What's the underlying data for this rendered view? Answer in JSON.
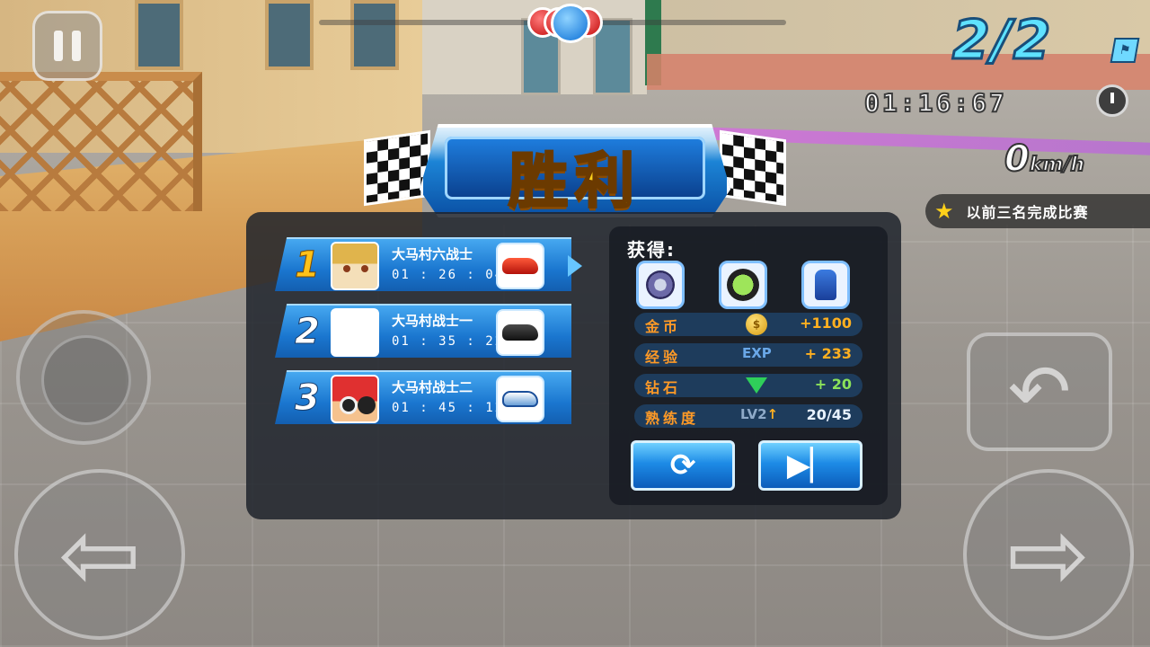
{
  "hud": {
    "lap": "2/2",
    "timer": "01:16:67",
    "speed_value": "0",
    "speed_unit": "km/h",
    "mission": "以前三名完成比赛"
  },
  "banner": {
    "title": "胜利"
  },
  "results": [
    {
      "rank": "1",
      "name": "大马村六战士",
      "time": "01 : 26 : 04",
      "car": "red-sportscar"
    },
    {
      "rank": "2",
      "name": "大马村战士一",
      "time": "01 : 35 : 22",
      "car": "black-sportscar"
    },
    {
      "rank": "3",
      "name": "大马村战士二",
      "time": "01 : 45 : 12",
      "car": "white-racecar"
    }
  ],
  "rewards": {
    "title": "获得:",
    "items": [
      "steering-wheel-icon",
      "tire-icon",
      "seat-icon"
    ],
    "stats": [
      {
        "label": "金币",
        "icon": "coin-icon",
        "value": "+1100"
      },
      {
        "label": "经验",
        "icon_text": "EXP",
        "value": "+ 233"
      },
      {
        "label": "钻石",
        "icon": "diamond-icon",
        "value": "+ 20"
      },
      {
        "label": "熟练度",
        "icon_text": "LV2",
        "value": "20/45"
      }
    ]
  },
  "colors": {
    "accent": "#1d8be6",
    "gold": "#ffc21a",
    "orange": "#ff9a26"
  }
}
